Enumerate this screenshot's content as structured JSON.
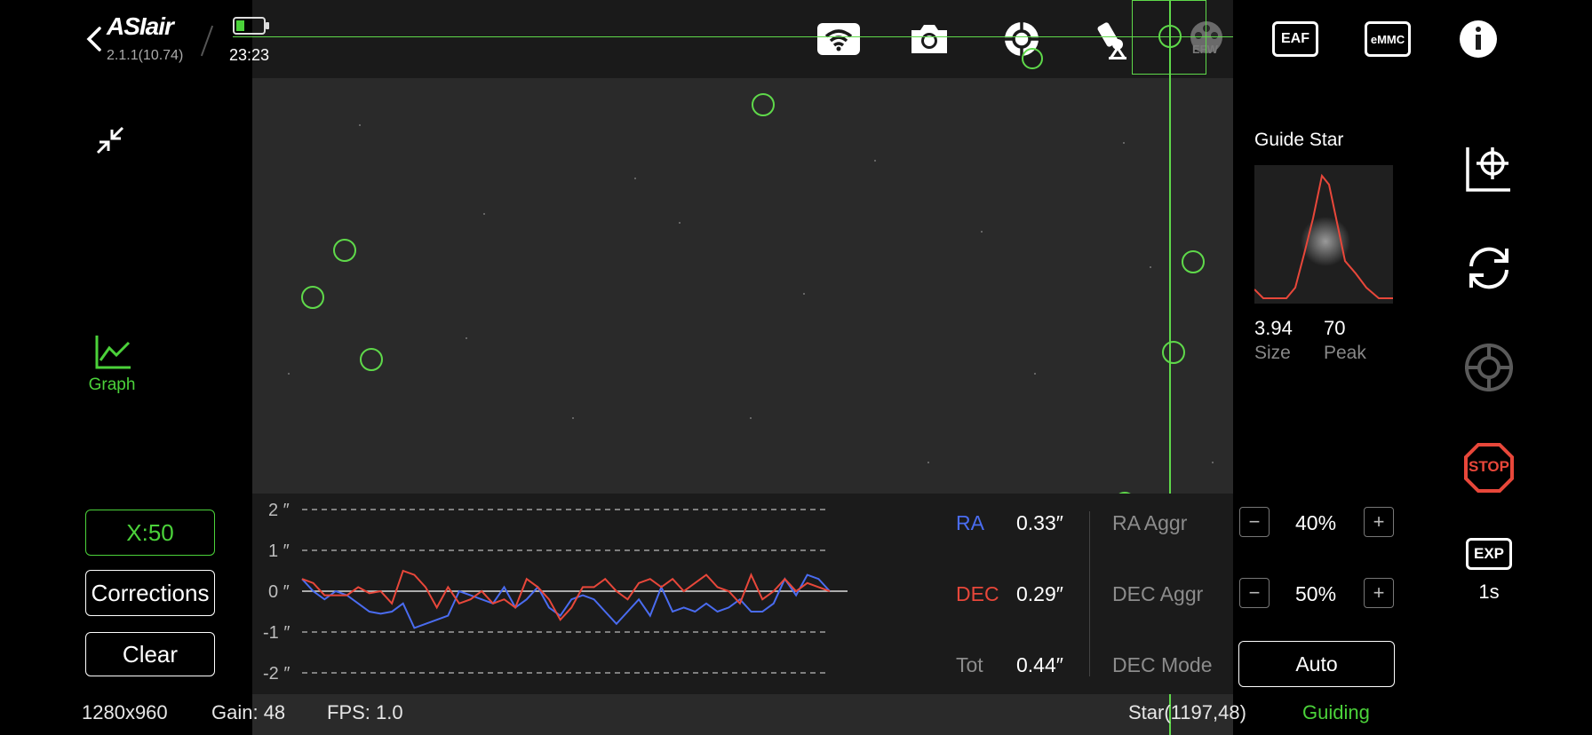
{
  "header": {
    "app_name": "ASIair",
    "version": "2.1.1(10.74)",
    "time": "23:23",
    "top_icons": [
      "wifi-icon",
      "camera-icon",
      "guide-scope-icon",
      "telescope-mount-icon",
      "filter-wheel-icon",
      "eaf-icon",
      "emmc-icon",
      "info-icon"
    ],
    "efw_label": "EFW",
    "eaf_label": "EAF",
    "emmc_label": "eMMC"
  },
  "left": {
    "graph_label": "Graph",
    "scale_button": "X:50",
    "corrections_button": "Corrections",
    "clear_button": "Clear"
  },
  "guide_star": {
    "title": "Guide Star",
    "size_value": "3.94",
    "size_label": "Size",
    "peak_value": "70",
    "peak_label": "Peak"
  },
  "right_tools": {
    "exp_label": "EXP",
    "exp_value": "1s",
    "stop_label": "STOP"
  },
  "graph": {
    "y_ticks": [
      "2 ″",
      "1 ″",
      "0 ″",
      "-1 ″",
      "-2 ″"
    ],
    "ra_label": "RA",
    "ra_value": "0.33″",
    "dec_label": "DEC",
    "dec_value": "0.29″",
    "tot_label": "Tot",
    "tot_value": "0.44″",
    "ra_aggr_label": "RA Aggr",
    "ra_aggr_value": "40%",
    "dec_aggr_label": "DEC Aggr",
    "dec_aggr_value": "50%",
    "dec_mode_label": "DEC Mode",
    "dec_mode_value": "Auto",
    "minus": "−",
    "plus": "+",
    "colors": {
      "ra": "#4a6cf0",
      "dec": "#e8473a"
    }
  },
  "chart_data": {
    "type": "line",
    "ylim": [
      -2,
      2
    ],
    "series": [
      {
        "name": "RA",
        "values": [
          0.3,
          0.0,
          -0.2,
          0.0,
          -0.1,
          -0.3,
          -0.5,
          -0.55,
          -0.5,
          -0.3,
          -0.9,
          -0.8,
          -0.7,
          -0.6,
          0.0,
          -0.1,
          -0.2,
          -0.3,
          0.1,
          -0.4,
          -0.2,
          0.1,
          -0.4,
          -0.6,
          -0.2,
          -0.1,
          -0.2,
          -0.5,
          -0.8,
          -0.5,
          -0.2,
          -0.6,
          0.1,
          -0.5,
          -0.4,
          -0.5,
          -0.3,
          -0.5,
          -0.4,
          -0.2,
          -0.5,
          -0.5,
          -0.3,
          0.3,
          -0.1,
          0.4,
          0.3,
          0.0
        ]
      },
      {
        "name": "DEC",
        "values": [
          0.3,
          0.2,
          -0.1,
          -0.1,
          -0.1,
          0.1,
          -0.05,
          0.0,
          -0.3,
          0.5,
          0.4,
          0.1,
          -0.4,
          0.1,
          -0.3,
          -0.2,
          0.0,
          -0.3,
          -0.2,
          -0.4,
          0.3,
          0.1,
          -0.2,
          -0.7,
          -0.4,
          0.1,
          0.1,
          0.3,
          0.0,
          -0.2,
          0.2,
          0.3,
          0.1,
          0.3,
          0.0,
          0.2,
          0.4,
          0.1,
          0.0,
          -0.3,
          0.4,
          -0.2,
          0.0,
          0.3,
          0.0,
          0.2,
          0.1,
          0.0
        ]
      }
    ]
  },
  "status_bar": {
    "resolution": "1280x960",
    "gain": "Gain: 48",
    "fps": "FPS: 1.0",
    "star": "Star(1197,48)",
    "state": "Guiding"
  }
}
